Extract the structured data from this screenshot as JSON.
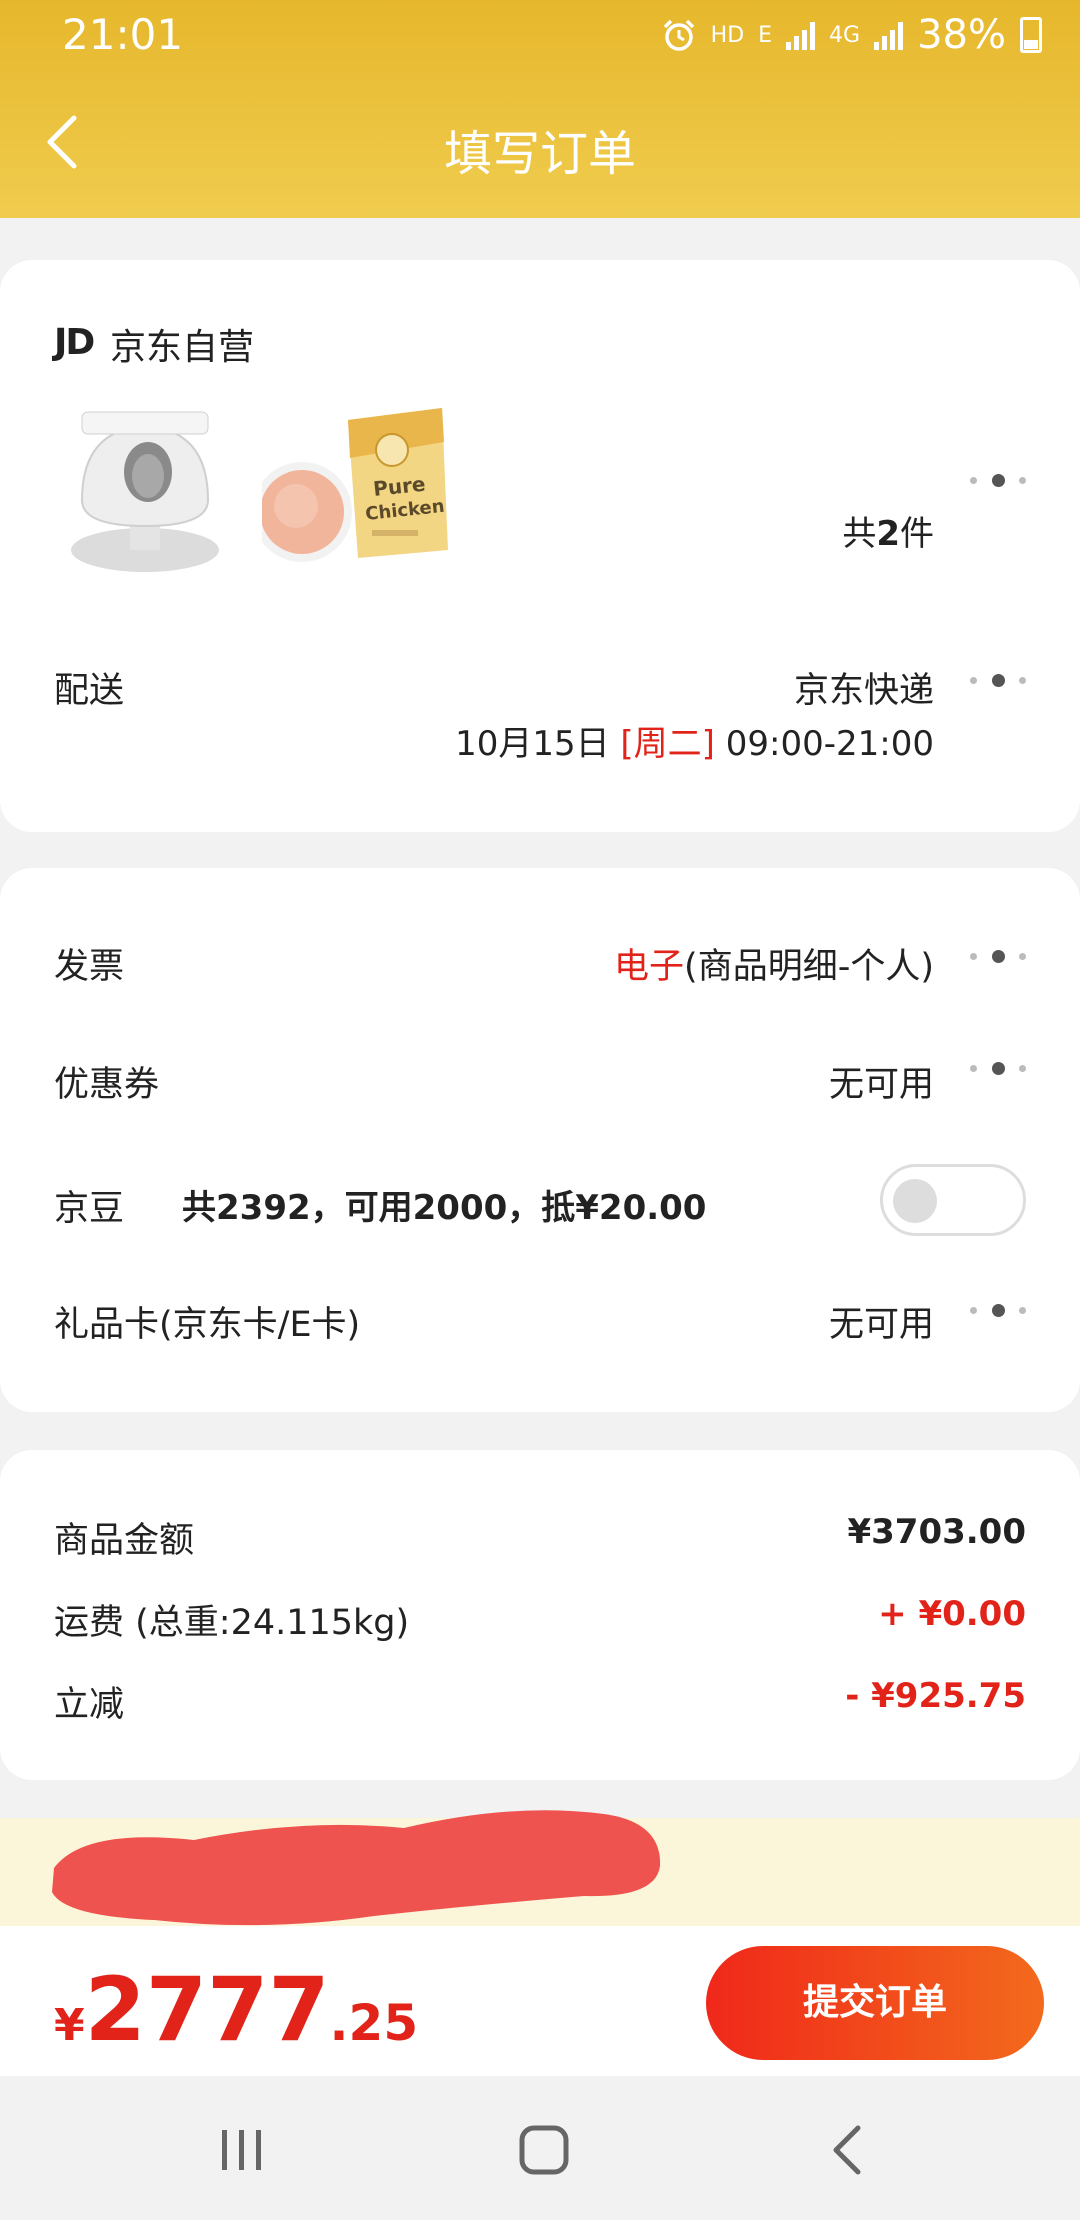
{
  "status_bar": {
    "time": "21:01",
    "hd": "HD",
    "net_e": "E",
    "net_4g": "4G",
    "battery": "38%",
    "icons": [
      "alarm-icon",
      "signal-icon",
      "signal-icon",
      "battery-icon"
    ]
  },
  "header": {
    "title": "填写订单",
    "back_icon": "chevron-left-icon"
  },
  "store": {
    "logo": "JD",
    "name": "京东自营",
    "product_images": [
      "cat-litter-box-product",
      "pure-chicken-cat-food-product"
    ],
    "count_prefix": "共",
    "count_num": "2",
    "count_suffix": "件"
  },
  "delivery": {
    "label": "配送",
    "carrier": "京东快递",
    "date": "10月15日",
    "weekday": "[周二]",
    "time_range": "09:00-21:00"
  },
  "invoice": {
    "label": "发票",
    "type": "电子",
    "detail": "(商品明细-个人)"
  },
  "coupon": {
    "label": "优惠券",
    "value": "无可用"
  },
  "jingdou": {
    "label": "京豆",
    "info": "共2392，可用2000，抵¥20.00",
    "enabled": false
  },
  "gift_card": {
    "label": "礼品卡(京东卡/E卡)",
    "value": "无可用"
  },
  "summary": {
    "goods_label": "商品金额",
    "goods_value": "¥3703.00",
    "shipping_label": "运费 (总重:24.115kg)",
    "shipping_value": "+ ¥0.00",
    "discount_label": "立减",
    "discount_value": "- ¥925.75"
  },
  "footer": {
    "currency": "¥",
    "total_int": "2777",
    "total_dec": ".25",
    "submit_label": "提交订单"
  },
  "navbar": {
    "icons": [
      "recent-apps-icon",
      "home-icon",
      "back-icon"
    ]
  },
  "colors": {
    "header_gradient_start": "#e6b72c",
    "header_gradient_end": "#f0cc4e",
    "accent_red": "#e2231a",
    "button_gradient_end": "#f36a1c",
    "address_bar_bg": "#fbf6d9",
    "redaction": "#ef5350"
  }
}
